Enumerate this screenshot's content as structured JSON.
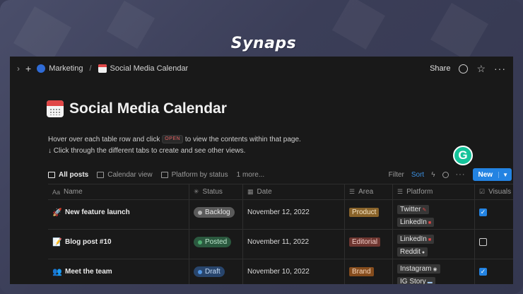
{
  "brand": {
    "logo_text": "Synaps"
  },
  "topbar": {
    "breadcrumb": [
      "Marketing",
      "Social Media Calendar"
    ],
    "share_label": "Share"
  },
  "page": {
    "title": "Social Media Calendar",
    "desc_line1_a": "Hover over each table row and click",
    "open_chip": "OPEN",
    "desc_line1_b": "to view the contents within that page.",
    "desc_line2": "↓ Click through the different tabs to create and see other views."
  },
  "views": {
    "tabs": [
      "All posts",
      "Calendar view",
      "Platform by status",
      "1 more..."
    ],
    "filter_label": "Filter",
    "sort_label": "Sort",
    "new_label": "New"
  },
  "grammarly": {
    "letter": "G"
  },
  "table": {
    "headers": {
      "name": "Name",
      "status": "Status",
      "date": "Date",
      "area": "Area",
      "platform": "Platform",
      "visuals": "Visuals"
    },
    "rows": [
      {
        "icon": "rocket-icon",
        "name": "New feature launch",
        "status": "Backlog",
        "date": "November 12, 2022",
        "area": "Product",
        "platforms": [
          "Twitter",
          "LinkedIn"
        ],
        "visuals_checked": true
      },
      {
        "icon": "memo-icon",
        "name": "Blog post #10",
        "status": "Posted",
        "date": "November 11, 2022",
        "area": "Editorial",
        "platforms": [
          "LinkedIn",
          "Reddit"
        ],
        "visuals_checked": false
      },
      {
        "icon": "people-icon",
        "name": "Meet the team",
        "status": "Draft",
        "date": "November 10, 2022",
        "area": "Brand",
        "platforms": [
          "Instagram",
          "IG Story"
        ],
        "visuals_checked": true
      }
    ]
  },
  "colors": {
    "accent": "#2383e2",
    "status_backlog_bg": "#5a5a5a",
    "status_posted_bg": "#2b593f",
    "status_draft_bg": "#28456c",
    "area_product": "#89632a",
    "area_editorial": "#6e3630",
    "area_brand": "#854c1d"
  }
}
